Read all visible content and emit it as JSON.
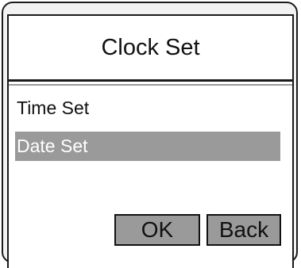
{
  "header": {
    "title": "Clock Set"
  },
  "menu": {
    "items": [
      {
        "label": "Time Set",
        "selected": false
      },
      {
        "label": "Date Set",
        "selected": true
      }
    ]
  },
  "buttons": {
    "ok_label": "OK",
    "back_label": "Back"
  },
  "colors": {
    "highlight": "#9a9a9a",
    "border": "#1a1a1a",
    "background": "#ffffff"
  }
}
